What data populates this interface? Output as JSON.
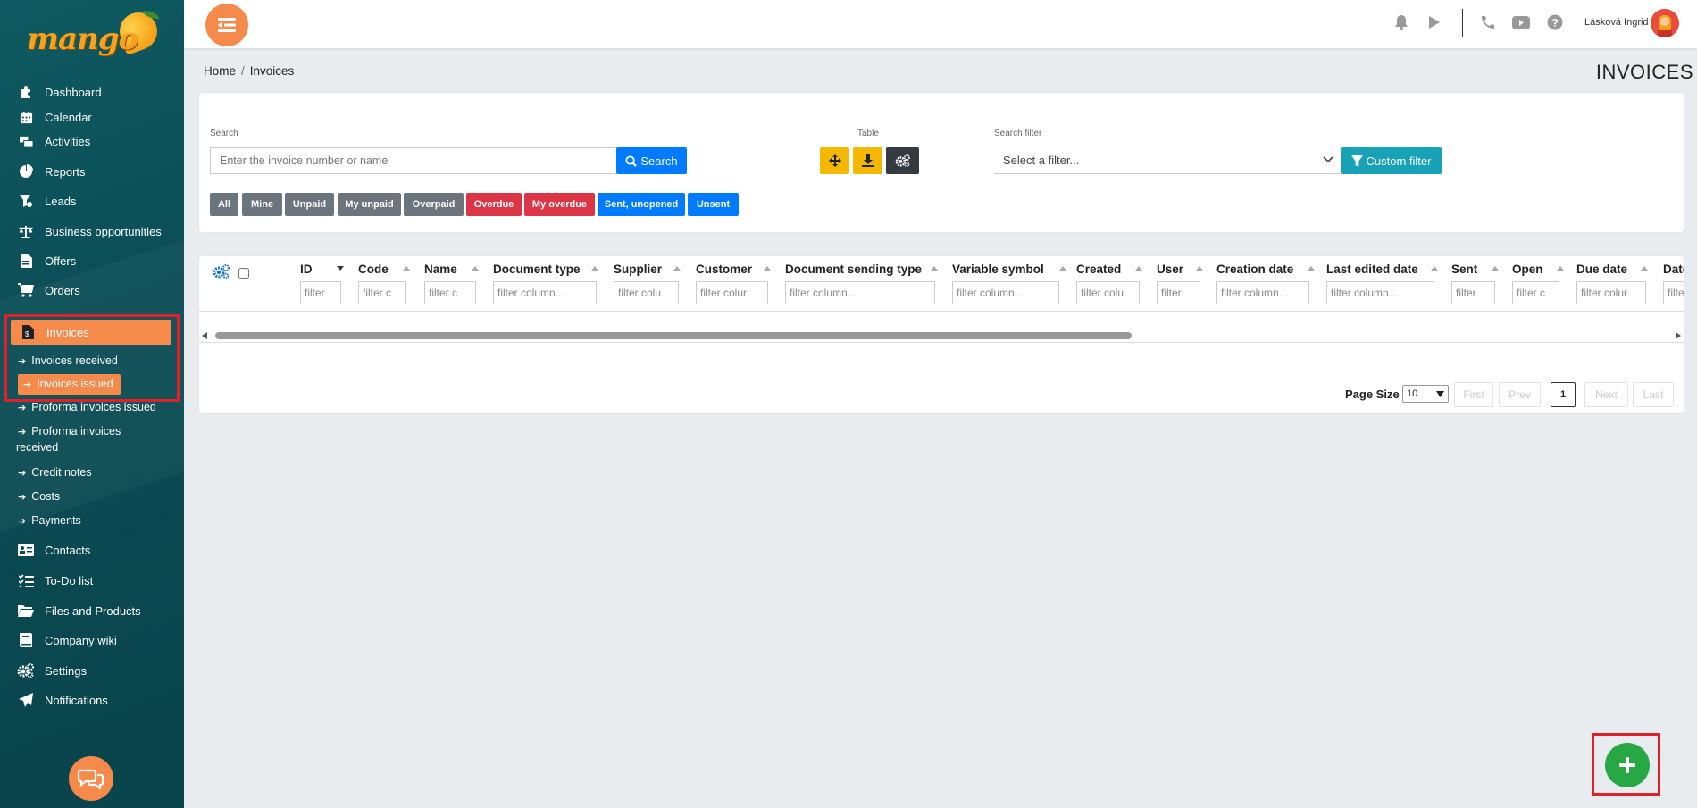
{
  "app": {
    "logo_text": "mango",
    "user_name": "Lásková Ingrid",
    "accent": "#f58a4b",
    "sidebar_bg": "#0b4d56"
  },
  "sidebar": {
    "items": [
      {
        "label": "Dashboard",
        "icon": "puzzle-icon"
      },
      {
        "label": "Calendar",
        "icon": "calendar-icon"
      },
      {
        "label": "Activities",
        "icon": "activities-icon"
      },
      {
        "label": "Reports",
        "icon": "pie-chart-icon"
      },
      {
        "label": "Leads",
        "icon": "funnel-icon"
      },
      {
        "label": "Business opportunities",
        "icon": "scales-icon"
      },
      {
        "label": "Offers",
        "icon": "document-icon"
      },
      {
        "label": "Orders",
        "icon": "cart-icon"
      },
      {
        "label": "Invoices",
        "icon": "invoice-icon"
      },
      {
        "label": "Contacts",
        "icon": "contact-card-icon"
      },
      {
        "label": "To-Do list",
        "icon": "checklist-icon"
      },
      {
        "label": "Files and Products",
        "icon": "folder-icon"
      },
      {
        "label": "Company wiki",
        "icon": "book-icon"
      },
      {
        "label": "Settings",
        "icon": "gears-icon"
      },
      {
        "label": "Notifications",
        "icon": "paper-plane-icon"
      }
    ],
    "sub_items": [
      {
        "label": "Invoices received"
      },
      {
        "label": "Invoices issued"
      },
      {
        "label": "Proforma invoices issued"
      },
      {
        "label": "Proforma invoices"
      },
      {
        "label": "received"
      },
      {
        "label": "Credit notes"
      },
      {
        "label": "Costs"
      },
      {
        "label": "Payments"
      }
    ]
  },
  "breadcrumb": {
    "home": "Home",
    "sep": "/",
    "current": "Invoices"
  },
  "page_title": "INVOICES",
  "search": {
    "label": "Search",
    "placeholder": "Enter the invoice number or name",
    "button": "Search",
    "table_label": "Table",
    "filter_label": "Search filter",
    "filter_select": "Select a filter...",
    "custom_filter": "Custom filter"
  },
  "filter_tags": [
    {
      "label": "All",
      "color": "#6c757d"
    },
    {
      "label": "Mine",
      "color": "#6c757d"
    },
    {
      "label": "Unpaid",
      "color": "#6c757d"
    },
    {
      "label": "My unpaid",
      "color": "#6c757d"
    },
    {
      "label": "Overpaid",
      "color": "#6c757d"
    },
    {
      "label": "Overdue",
      "color": "#dc3545"
    },
    {
      "label": "My overdue",
      "color": "#dc3545"
    },
    {
      "label": "Sent, unopened",
      "color": "#007bff"
    },
    {
      "label": "Unsent",
      "color": "#007bff"
    }
  ],
  "table": {
    "columns": [
      {
        "label": "ID",
        "filter": "filter"
      },
      {
        "label": "Code",
        "filter": "filter c"
      },
      {
        "label": "Name",
        "filter": "filter c"
      },
      {
        "label": "Document type",
        "filter": "filter column..."
      },
      {
        "label": "Supplier",
        "filter": "filter colu"
      },
      {
        "label": "Customer",
        "filter": "filter colur"
      },
      {
        "label": "Document sending type",
        "filter": "filter column..."
      },
      {
        "label": "Variable symbol",
        "filter": "filter column..."
      },
      {
        "label": "Created",
        "filter": "filter colu"
      },
      {
        "label": "User",
        "filter": "filter"
      },
      {
        "label": "Creation date",
        "filter": "filter column..."
      },
      {
        "label": "Last edited date",
        "filter": "filter column..."
      },
      {
        "label": "Sent",
        "filter": "filter"
      },
      {
        "label": "Open",
        "filter": "filter c"
      },
      {
        "label": "Due date",
        "filter": "filter colur"
      },
      {
        "label": "Date",
        "filter": "filte"
      }
    ]
  },
  "pagination": {
    "page_size_label": "Page Size",
    "page_size": "10",
    "first": "First",
    "prev": "Prev",
    "current": "1",
    "next": "Next",
    "last": "Last"
  }
}
